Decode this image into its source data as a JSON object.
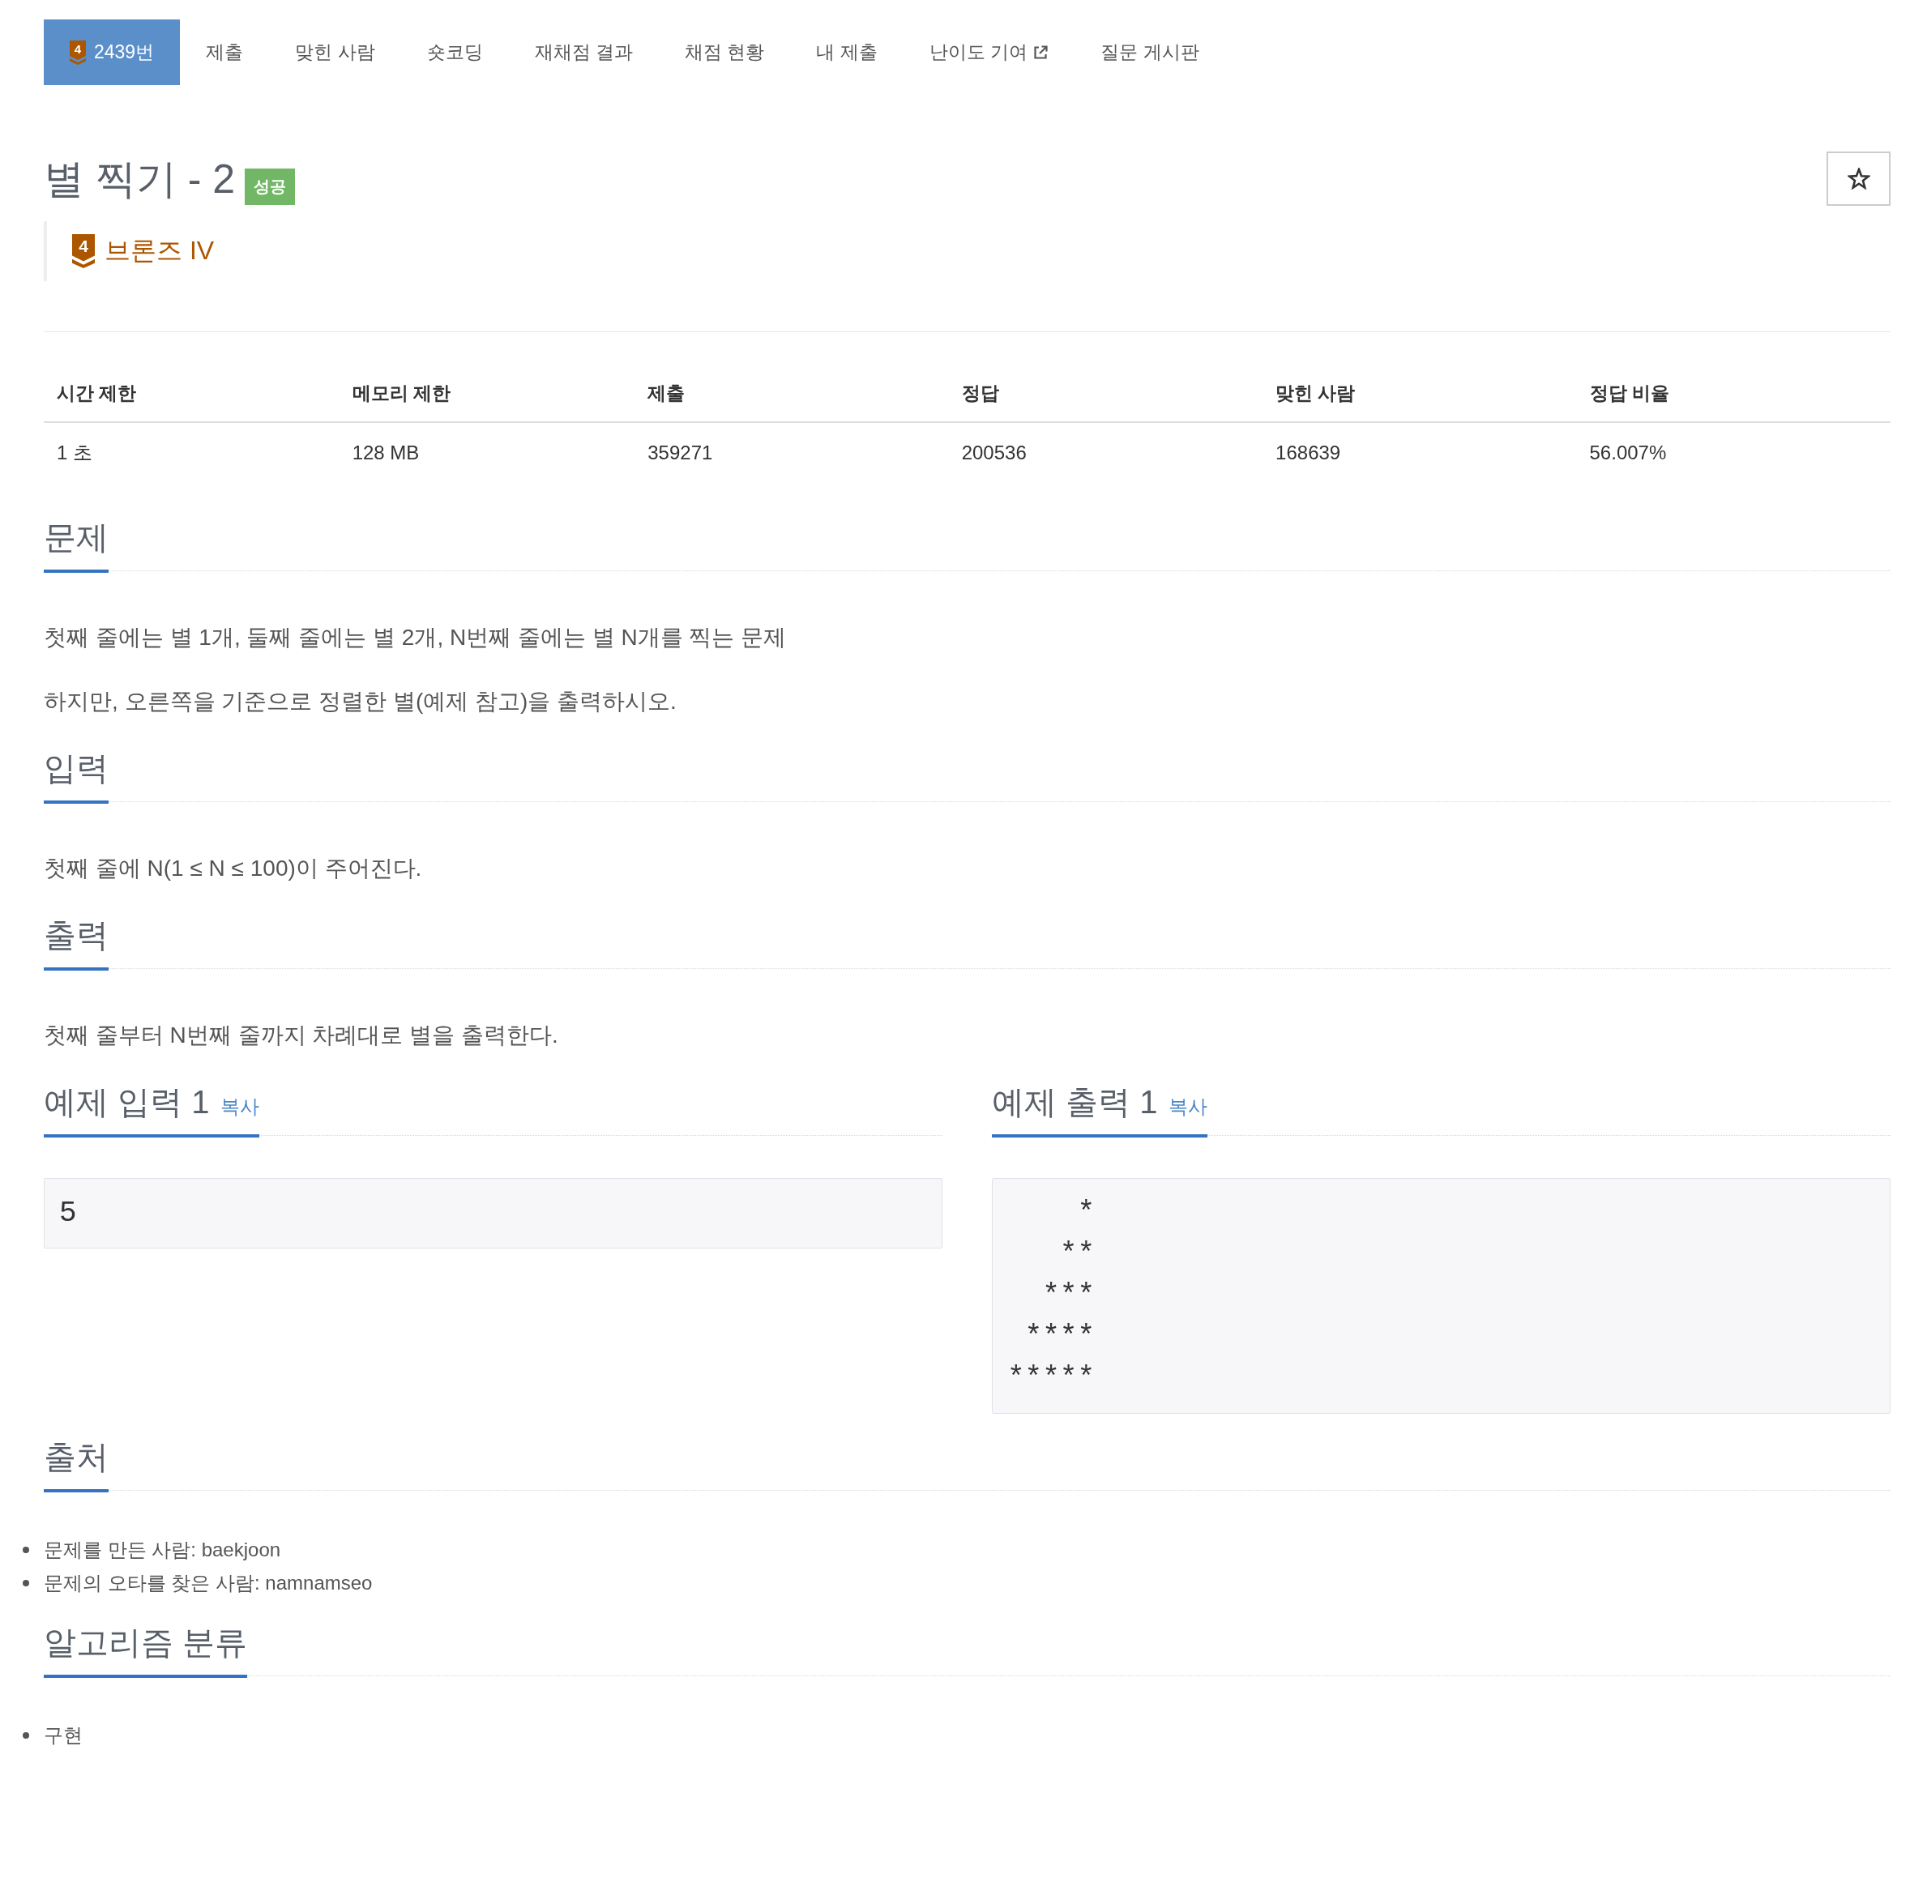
{
  "nav": {
    "tabs": [
      {
        "kind": "problem",
        "badge": "4",
        "label": "2439번",
        "selected": true
      },
      {
        "kind": "page",
        "label": "제출",
        "selected": false
      },
      {
        "kind": "page",
        "label": "맞힌 사람",
        "selected": false
      },
      {
        "kind": "page",
        "label": "숏코딩",
        "selected": false
      },
      {
        "kind": "page",
        "label": "재채점 결과",
        "selected": false
      },
      {
        "kind": "page",
        "label": "채점 현황",
        "selected": false
      },
      {
        "kind": "page",
        "label": "내 제출",
        "selected": false
      },
      {
        "kind": "external",
        "label": "난이도 기여",
        "selected": false
      },
      {
        "kind": "page",
        "label": "질문 게시판",
        "selected": false
      }
    ]
  },
  "problem": {
    "title": "별 찍기 - 2",
    "result_badge": "성공",
    "favorite": {
      "starred": false
    },
    "tier": {
      "badge": "4",
      "name": "브론즈 IV"
    }
  },
  "stats_table": {
    "columns": [
      "시간 제한",
      "메모리 제한",
      "제출",
      "정답",
      "맞힌 사람",
      "정답 비율"
    ],
    "rows": [
      [
        "1 초",
        "128 MB",
        "359271",
        "200536",
        "168639",
        "56.007%"
      ]
    ]
  },
  "sections": [
    {
      "kind": "text",
      "title": "문제",
      "paragraphs": [
        "첫째 줄에는 별 1개, 둘째 줄에는 별 2개, N번째 줄에는 별 N개를 찍는 문제",
        "하지만, 오른쪽을 기준으로 정렬한 별(예제 참고)을 출력하시오."
      ]
    },
    {
      "kind": "text",
      "title": "입력",
      "paragraphs": [
        "첫째 줄에 N(1 ≤ N ≤ 100)이 주어진다."
      ]
    },
    {
      "kind": "text",
      "title": "출력",
      "paragraphs": [
        "첫째 줄부터 N번째 줄까지 차례대로 별을 출력한다."
      ]
    },
    {
      "kind": "samples",
      "samples": [
        {
          "title": "예제 입력 1",
          "copy": "복사",
          "content": "5"
        },
        {
          "title": "예제 출력 1",
          "copy": "복사",
          "content": "    *\n   **\n  ***\n ****\n*****"
        }
      ]
    },
    {
      "kind": "list",
      "title": "출처",
      "items": [
        "문제를 만든 사람: baekjoon",
        "문제의 오타를 찾은 사람: namnamseo"
      ]
    },
    {
      "kind": "list",
      "title": "알고리즘 분류",
      "items": [
        "구현"
      ]
    }
  ]
}
